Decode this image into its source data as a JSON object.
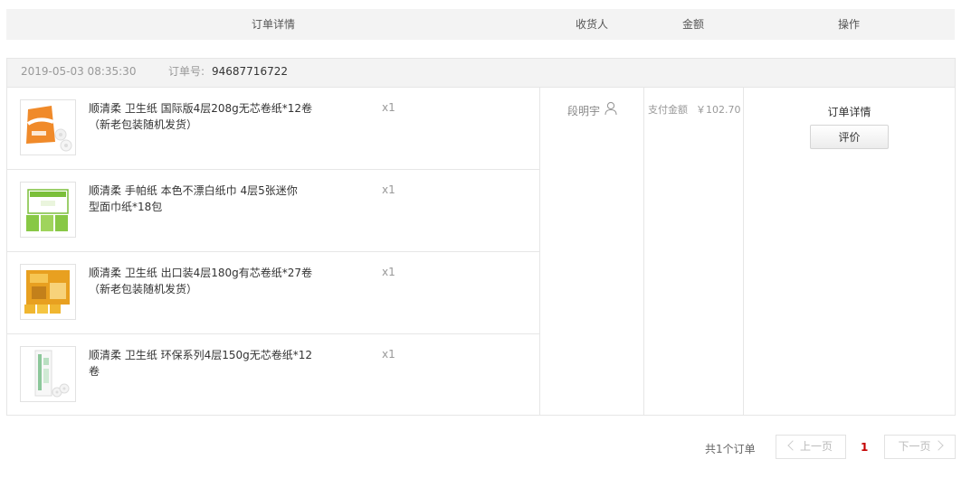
{
  "header": {
    "col_detail": "订单详情",
    "col_receiver": "收货人",
    "col_amount": "金额",
    "col_ops": "操作"
  },
  "order": {
    "time": "2019-05-03 08:35:30",
    "number_label": "订单号:",
    "number": "94687716722",
    "items": [
      {
        "name_line1": "顺清柔 卫生纸 国际版4层208g无芯卷纸*12卷",
        "name_line2": "（新老包装随机发货）",
        "qty": "x1",
        "icon": "toilet-roll-pack-orange"
      },
      {
        "name_line1": "顺清柔 手帕纸 本色不漂白纸巾 4层5张迷你",
        "name_line2": "型面巾纸*18包",
        "qty": "x1",
        "icon": "handkerchief-pack-green"
      },
      {
        "name_line1": "顺清柔 卫生纸 出口装4层180g有芯卷纸*27卷",
        "name_line2": "（新老包装随机发货）",
        "qty": "x1",
        "icon": "toilet-roll-box-yellow"
      },
      {
        "name_line1": "顺清柔 卫生纸 环保系列4层150g无芯卷纸*12",
        "name_line2": "卷",
        "qty": "x1",
        "icon": "toilet-roll-pack-green"
      }
    ],
    "receiver": "段明宇",
    "amount_label": "支付金额",
    "amount": "￥102.70",
    "op_detail": "订单详情",
    "op_review": "评价"
  },
  "pager": {
    "total": "共1个订单",
    "prev": "上一页",
    "current": "1",
    "next": "下一页"
  }
}
